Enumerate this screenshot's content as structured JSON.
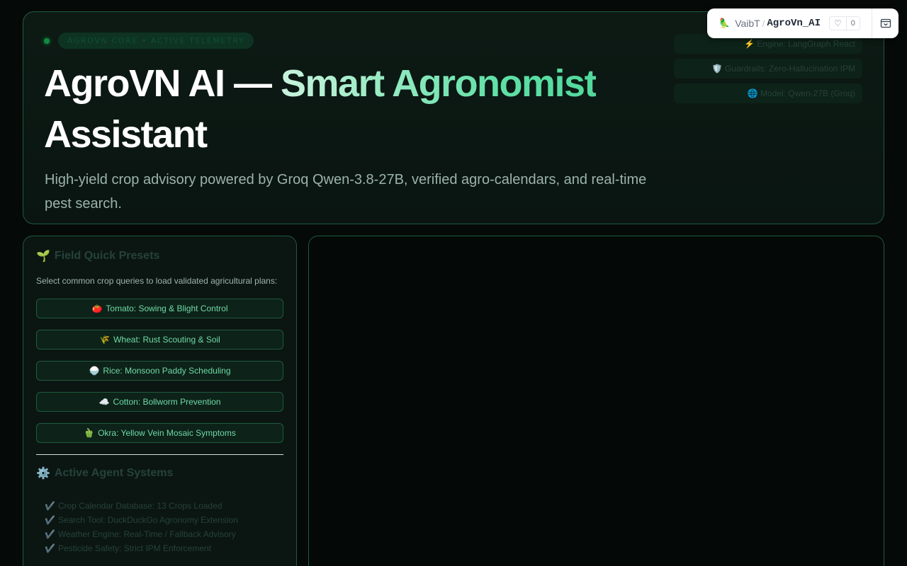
{
  "hero": {
    "status_pill": "AGROVN CORE • ACTIVE TELEMETRY",
    "title_plain": "AgroVN AI — ",
    "title_highlight": "Smart Agronomist",
    "title_after": "Assistant",
    "subtitle": "High-yield crop advisory powered by Groq Qwen-3.8-27B, verified agro-calendars, and real-time pest search.",
    "tags": [
      {
        "icon": "⚡",
        "label": "Engine: LangGraph React"
      },
      {
        "icon": "🛡️",
        "label": "Guardrails: Zero-Hallucination IPM"
      },
      {
        "icon": "🌐",
        "label": "Model: Qwen-27B (Groq)"
      }
    ]
  },
  "spaces_badge": {
    "avatar": "🦜",
    "owner": "VaibT",
    "separator": "/",
    "repo": "AgroVn_AI",
    "like_icon": "♡",
    "like_count": "0"
  },
  "sidebar": {
    "presets_icon": "🌱",
    "presets_title": "Field Quick Presets",
    "presets_desc": "Select common crop queries to load validated agricultural plans:",
    "presets": [
      {
        "icon": "🍅",
        "label": "Tomato: Sowing & Blight Control"
      },
      {
        "icon": "🌾",
        "label": "Wheat: Rust Scouting & Soil"
      },
      {
        "icon": "🍚",
        "label": "Rice: Monsoon Paddy Scheduling"
      },
      {
        "icon": "☁️",
        "label": "Cotton: Bollworm Prevention"
      },
      {
        "icon": "🫑",
        "label": "Okra: Yellow Vein Mosaic Symptoms"
      }
    ],
    "agents_icon": "⚙️",
    "agents_title": "Active Agent Systems",
    "agents": [
      {
        "icon": "✔️",
        "label": "Crop Calendar Database: 13 Crops Loaded"
      },
      {
        "icon": "✔️",
        "label": "Search Tool: DuckDuckGo Agronomy Extension"
      },
      {
        "icon": "✔️",
        "label": "Weather Engine: Real-Time / Fallback Advisory"
      },
      {
        "icon": "✔️",
        "label": "Pesticide Safety: Strict IPM Enforcement"
      }
    ]
  },
  "colors": {
    "accent": "#5fe0a5",
    "border": "#1f5a3f",
    "background": "#050907"
  }
}
